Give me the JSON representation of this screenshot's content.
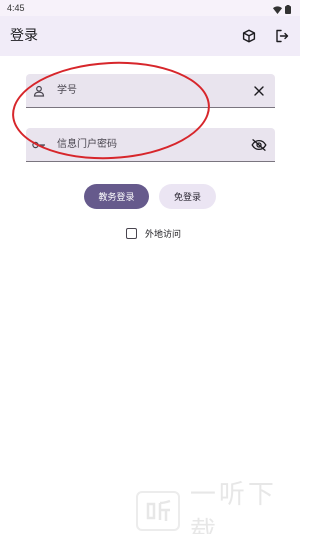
{
  "status_bar": {
    "time": "4:45"
  },
  "app_bar": {
    "title": "登录"
  },
  "form": {
    "student_id_label": "学号",
    "password_label": "信息门户密码"
  },
  "buttons": {
    "primary_label": "教务登录",
    "secondary_label": "免登录"
  },
  "checkbox": {
    "label": "外地访问",
    "checked": false
  },
  "watermark": {
    "text": "一听下载"
  },
  "colors": {
    "app_bar_bg": "#f1ecf8",
    "field_bg": "#e9e4ee",
    "primary_button": "#665a8c",
    "secondary_button": "#ebe5f3",
    "annotation": "#d7262b"
  },
  "icons": {
    "app_bar_actions": [
      "cube-icon",
      "logout-icon"
    ],
    "student_id_lead": "person-icon",
    "student_id_trail": "close-icon",
    "password_lead": "key-icon",
    "password_trail": "visibility-off-icon"
  }
}
